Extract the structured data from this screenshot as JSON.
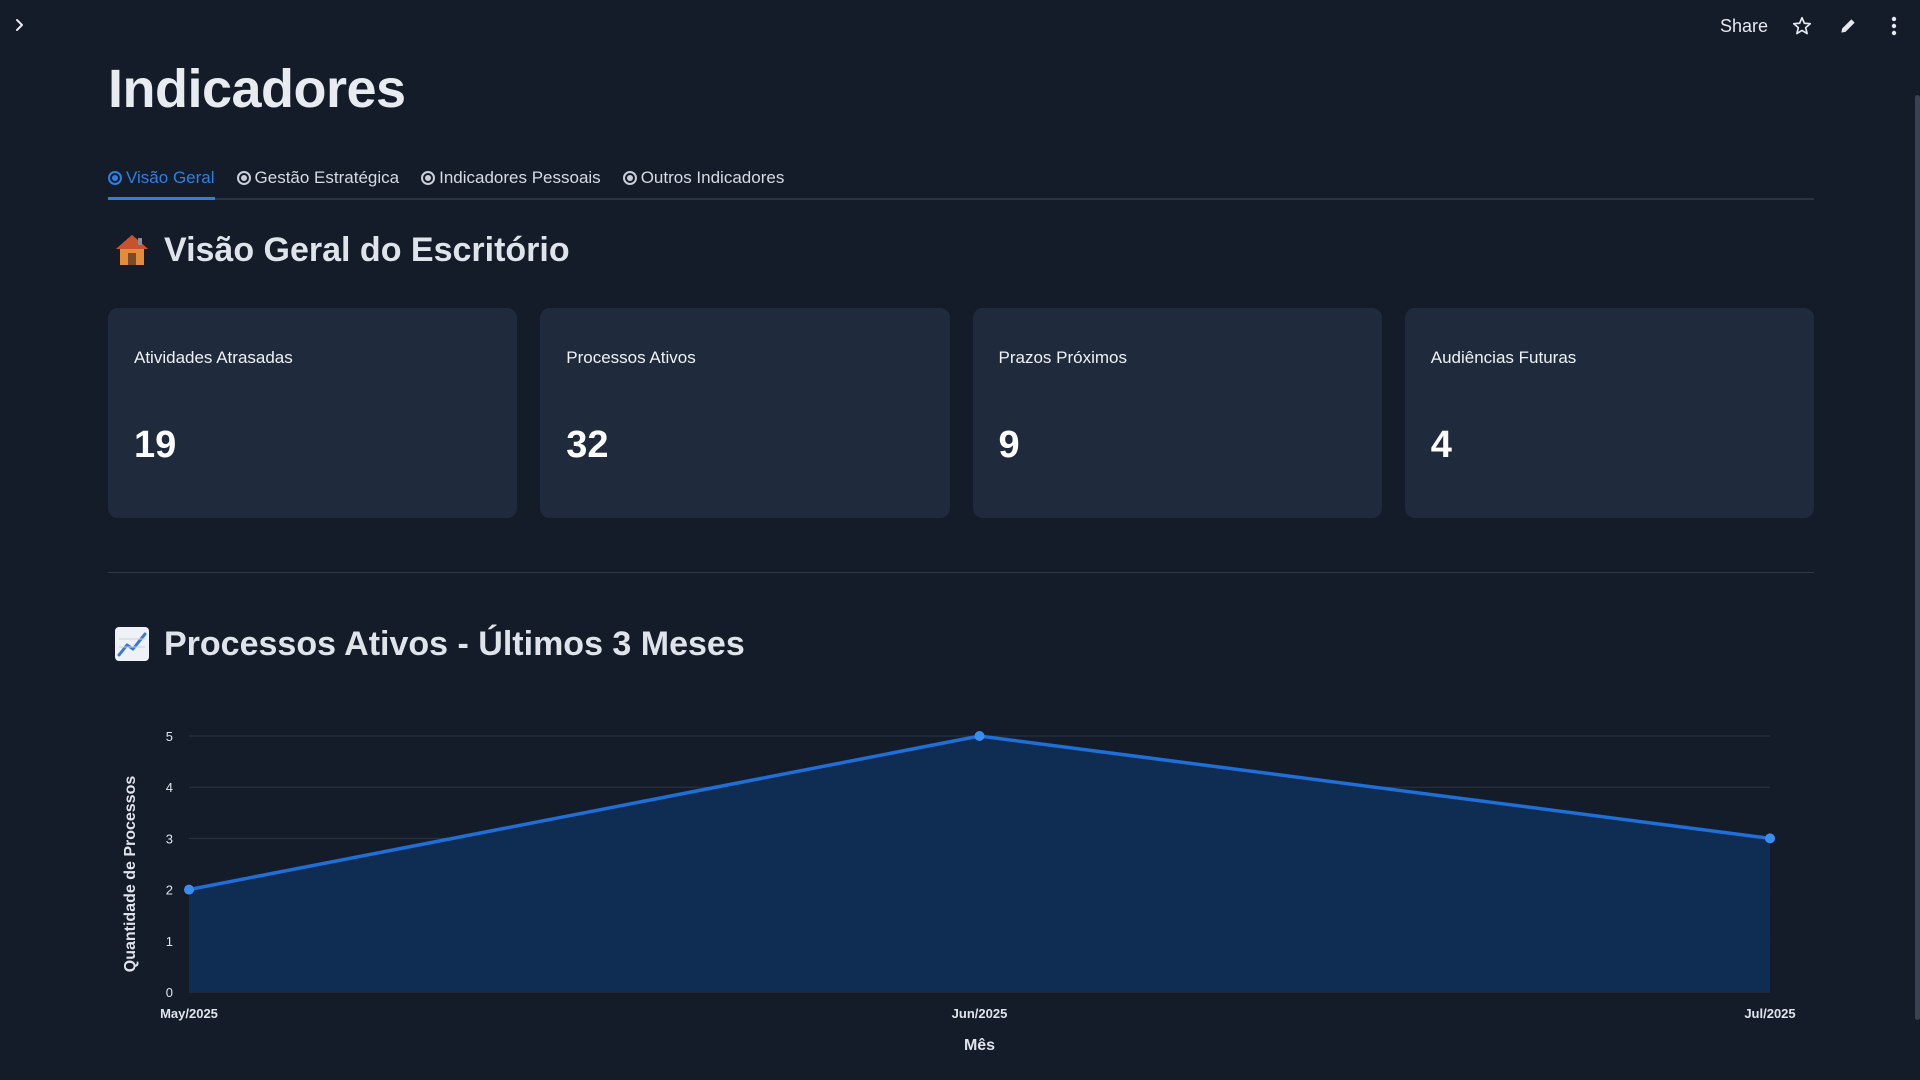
{
  "topbar": {
    "share_label": "Share",
    "icons": [
      "chevron-right-icon",
      "star-icon",
      "pencil-icon",
      "more-vertical-icon"
    ]
  },
  "page": {
    "title": "Indicadores"
  },
  "tabs": [
    {
      "label": "Visão Geral",
      "active": true
    },
    {
      "label": "Gestão Estratégica",
      "active": false
    },
    {
      "label": "Indicadores Pessoais",
      "active": false
    },
    {
      "label": "Outros Indicadores",
      "active": false
    }
  ],
  "overview": {
    "title": "Visão Geral do Escritório",
    "icon": "house-icon"
  },
  "cards": [
    {
      "label": "Atividades Atrasadas",
      "value": "19"
    },
    {
      "label": "Processos Ativos",
      "value": "32"
    },
    {
      "label": "Prazos Próximos",
      "value": "9"
    },
    {
      "label": "Audiências Futuras",
      "value": "4"
    }
  ],
  "chart_section": {
    "title": "Processos Ativos - Últimos 3 Meses",
    "icon": "chart-increasing-icon"
  },
  "chart_data": {
    "type": "area",
    "categories": [
      "May/2025",
      "Jun/2025",
      "Jul/2025"
    ],
    "series": [
      {
        "values": [
          2,
          5,
          3
        ]
      }
    ],
    "xlabel": "Mês",
    "ylabel": "Quantidade de Processos",
    "ylim": [
      0,
      5
    ],
    "yticks": [
      0,
      1,
      2,
      3,
      4,
      5
    ],
    "grid": true,
    "colors": {
      "line": "#1f6fd6",
      "fill": "#0f2d55",
      "grid": "#2a3444",
      "text": "#e0e4ea"
    }
  },
  "colors": {
    "background": "#141c2a",
    "card": "#1f2b3c",
    "accent": "#2f7fe0"
  }
}
